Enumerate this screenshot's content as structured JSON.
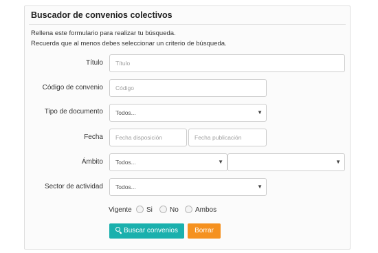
{
  "panel": {
    "title": "Buscador de convenios colectivos",
    "intro_line1": "Rellena este formulario para realizar tu búsqueda.",
    "intro_line2": "Recuerda que al menos debes seleccionar un criterio de búsqueda."
  },
  "form": {
    "titulo": {
      "label": "Título",
      "placeholder": "Título"
    },
    "codigo": {
      "label": "Código de convenio",
      "placeholder": "Código"
    },
    "tipo_documento": {
      "label": "Tipo de documento",
      "selected": "Todos..."
    },
    "fecha": {
      "label": "Fecha",
      "placeholder_disposicion": "Fecha disposición",
      "placeholder_publicacion": "Fecha publicación"
    },
    "ambito": {
      "label": "Ámbito",
      "selected": "Todos...",
      "selected_secondary": ""
    },
    "sector": {
      "label": "Sector de actividad",
      "selected": "Todos..."
    },
    "vigente": {
      "label": "Vigente",
      "options": [
        "Si",
        "No",
        "Ambos"
      ]
    }
  },
  "buttons": {
    "search_label": "Buscar convenios",
    "clear_label": "Borrar"
  },
  "icons": {
    "dropdown": "chevron-down-icon",
    "search": "search-icon"
  },
  "colors": {
    "search_button": "#1ab0ad",
    "clear_button": "#f5911f"
  }
}
